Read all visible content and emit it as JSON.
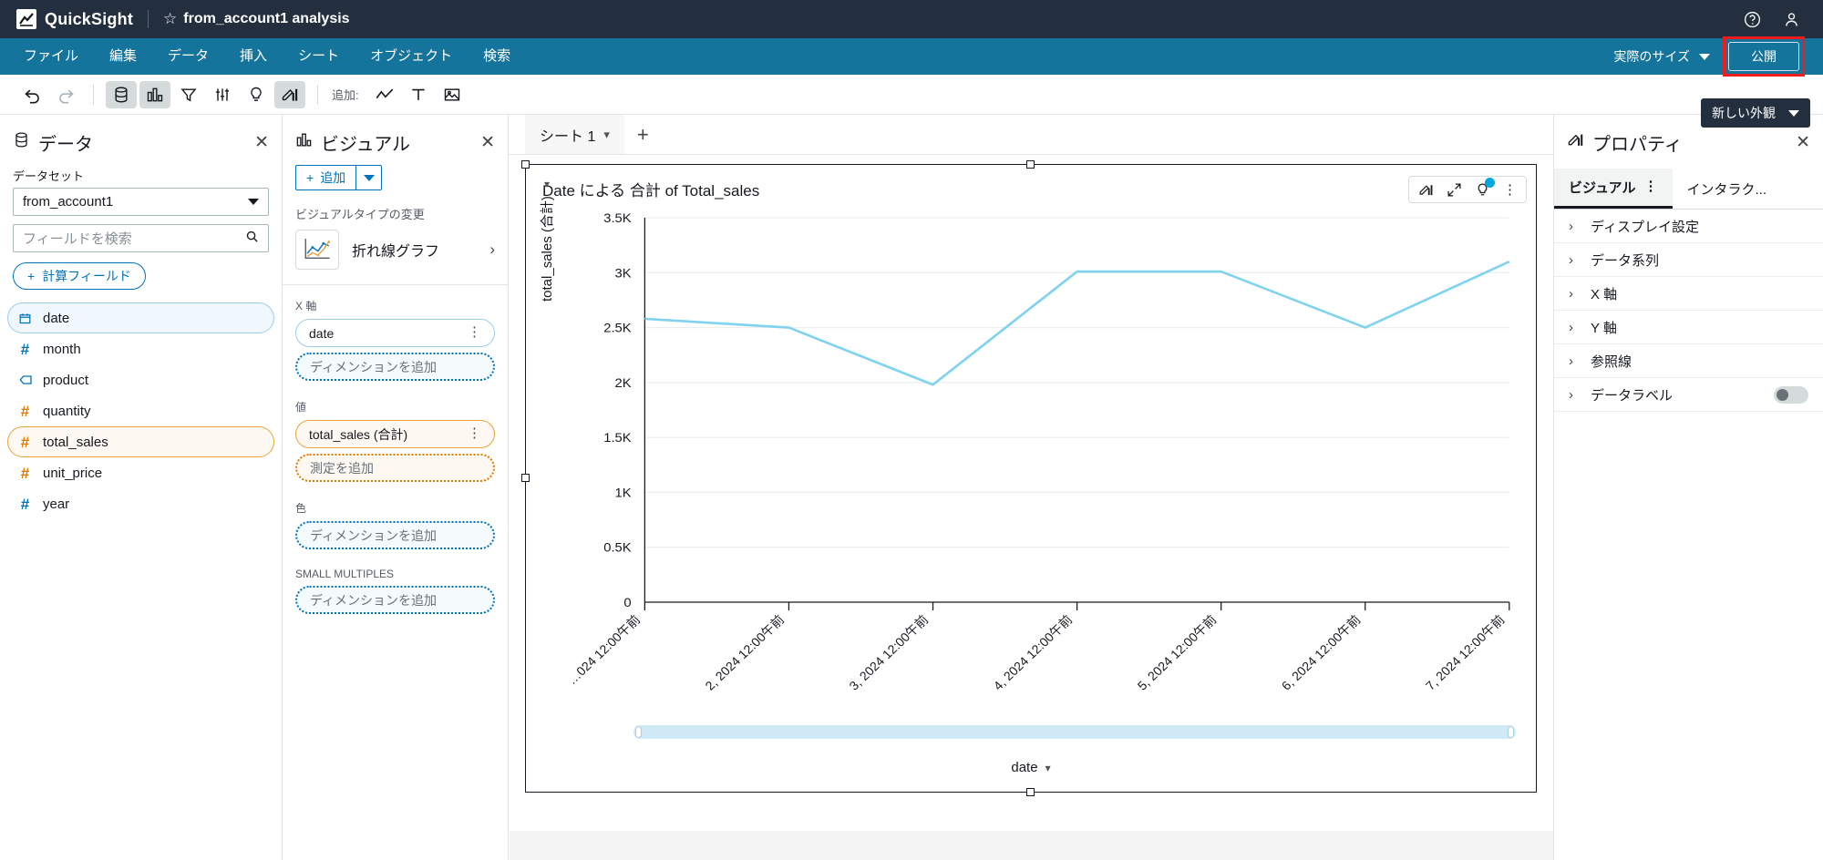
{
  "topbar": {
    "product_name": "QuickSight",
    "logo_icon": "quicksight-logo-icon",
    "star_icon": "star-outline-icon",
    "analysis_title": "from_account1 analysis",
    "help_icon": "help-circle-icon",
    "user_icon": "user-account-icon"
  },
  "menubar": {
    "items": [
      {
        "label": "ファイル",
        "name": "menu-file"
      },
      {
        "label": "編集",
        "name": "menu-edit"
      },
      {
        "label": "データ",
        "name": "menu-data"
      },
      {
        "label": "挿入",
        "name": "menu-insert"
      },
      {
        "label": "シート",
        "name": "menu-sheet"
      },
      {
        "label": "オブジェクト",
        "name": "menu-object"
      },
      {
        "label": "検索",
        "name": "menu-search"
      }
    ],
    "size_selector": "実際のサイズ",
    "publish_label": "公開",
    "publish_highlight_color": "#f01c1c"
  },
  "new_look": {
    "label": "新しい外観"
  },
  "toolbar": {
    "add_label": "追加:",
    "buttons": [
      {
        "name": "undo-icon",
        "state": "enabled"
      },
      {
        "name": "redo-icon",
        "state": "disabled"
      },
      {
        "name": "dataset-icon",
        "state": "active"
      },
      {
        "name": "visuals-icon",
        "state": "active"
      },
      {
        "name": "filter-icon",
        "state": "enabled"
      },
      {
        "name": "parameters-icon",
        "state": "enabled"
      },
      {
        "name": "insights-icon",
        "state": "enabled"
      },
      {
        "name": "themes-icon",
        "state": "active"
      },
      {
        "name": "add-line-chart-icon",
        "state": "enabled"
      },
      {
        "name": "add-text-icon",
        "state": "enabled"
      },
      {
        "name": "add-image-icon",
        "state": "enabled"
      }
    ]
  },
  "data_pane": {
    "title": "データ",
    "title_icon": "dataset-icon",
    "close_icon": "close-icon",
    "dataset_label": "データセット",
    "dataset_value": "from_account1",
    "search_placeholder": "フィールドを検索",
    "search_icon": "search-icon",
    "calculated_field_label": "計算フィールド",
    "fields": [
      {
        "name": "date",
        "type": "date",
        "icon": "calendar-icon",
        "color": "blue",
        "selected": "blue"
      },
      {
        "name": "month",
        "type": "number",
        "icon": "hash-icon",
        "color": "blue",
        "selected": "none"
      },
      {
        "name": "product",
        "type": "string",
        "icon": "tag-icon",
        "color": "blue",
        "selected": "none"
      },
      {
        "name": "quantity",
        "type": "number",
        "icon": "hash-icon",
        "color": "amber",
        "selected": "none"
      },
      {
        "name": "total_sales",
        "type": "number",
        "icon": "hash-icon",
        "color": "amber",
        "selected": "amber"
      },
      {
        "name": "unit_price",
        "type": "number",
        "icon": "hash-icon",
        "color": "amber",
        "selected": "none"
      },
      {
        "name": "year",
        "type": "number",
        "icon": "hash-icon",
        "color": "blue",
        "selected": "none"
      }
    ]
  },
  "visual_pane": {
    "title": "ビジュアル",
    "title_icon": "visuals-icon",
    "close_icon": "close-icon",
    "add_label": "追加",
    "change_type_label": "ビジュアルタイプの変更",
    "visual_type_name": "折れ線グラフ",
    "visual_type_icon": "line-chart-icon",
    "wells": [
      {
        "label": "X 軸",
        "name": "well-x-axis",
        "fields": [
          {
            "text": "date",
            "style": "filled-blue"
          }
        ],
        "drop_placeholder": "ディメンションを追加",
        "drop_style": "drop-blue"
      },
      {
        "label": "値",
        "name": "well-value",
        "fields": [
          {
            "text": "total_sales (合計)",
            "style": "filled-amber"
          }
        ],
        "drop_placeholder": "測定を追加",
        "drop_style": "drop-amber"
      },
      {
        "label": "色",
        "name": "well-color",
        "fields": [],
        "drop_placeholder": "ディメンションを追加",
        "drop_style": "drop-blue"
      },
      {
        "label": "SMALL MULTIPLES",
        "name": "well-small-multiples",
        "fields": [],
        "drop_placeholder": "ディメンションを追加",
        "drop_style": "drop-blue"
      }
    ]
  },
  "sheet": {
    "tab_label": "シート 1",
    "tab_chevron_icon": "chevron-down-icon",
    "add_sheet_icon": "plus-icon"
  },
  "visual": {
    "title": "Date による 合計 of Total_sales",
    "tools": [
      {
        "name": "visual-menu-format-icon",
        "badge": false
      },
      {
        "name": "maximize-icon",
        "badge": false
      },
      {
        "name": "insights-bulb-icon",
        "badge": true
      },
      {
        "name": "visual-kebab-menu-icon",
        "badge": false
      }
    ],
    "badge_color": "#00a8e1"
  },
  "chart_data": {
    "type": "line",
    "title": "Date による 合計 of Total_sales",
    "xlabel": "date",
    "ylabel": "total_sales (合計)",
    "ylim": [
      0,
      3500
    ],
    "grid": true,
    "legend": "none",
    "line_color": "#7fd3ee",
    "y_ticks": [
      "0",
      "0.5K",
      "1K",
      "1.5K",
      "2K",
      "2.5K",
      "3K",
      "3.5K"
    ],
    "y_tick_values": [
      0,
      500,
      1000,
      1500,
      2000,
      2500,
      3000,
      3500
    ],
    "x_tick_labels": [
      "…024 12:00午前",
      "2, 2024 12:00午前",
      "3, 2024 12:00午前",
      "4, 2024 12:00午前",
      "5, 2024 12:00午前",
      "6, 2024 12:00午前",
      "7, 2024 12:00午前"
    ],
    "categories": [
      "1",
      "2",
      "3",
      "4",
      "5",
      "6",
      "7"
    ],
    "values": [
      2580,
      2500,
      1980,
      3010,
      3010,
      2500,
      3100
    ],
    "series": [
      {
        "name": "total_sales (合計)",
        "values": [
          2580,
          2500,
          1980,
          3010,
          3010,
          2500,
          3100
        ]
      }
    ],
    "scrollbar_visible": true
  },
  "props_pane": {
    "title": "プロパティ",
    "title_icon": "themes-icon",
    "close_icon": "close-icon",
    "tabs": [
      {
        "label": "ビジュアル",
        "name": "tab-visual",
        "active": true,
        "kebab": true
      },
      {
        "label": "インタラク...",
        "name": "tab-interactions",
        "active": false,
        "kebab": false
      }
    ],
    "sections": [
      {
        "label": "ディスプレイ設定",
        "name": "prop-display-settings",
        "toggle": false
      },
      {
        "label": "データ系列",
        "name": "prop-data-series",
        "toggle": false
      },
      {
        "label": "X 軸",
        "name": "prop-x-axis",
        "toggle": false
      },
      {
        "label": "Y 軸",
        "name": "prop-y-axis",
        "toggle": false
      },
      {
        "label": "参照線",
        "name": "prop-reference-lines",
        "toggle": false
      },
      {
        "label": "データラベル",
        "name": "prop-data-labels",
        "toggle": true
      }
    ]
  }
}
